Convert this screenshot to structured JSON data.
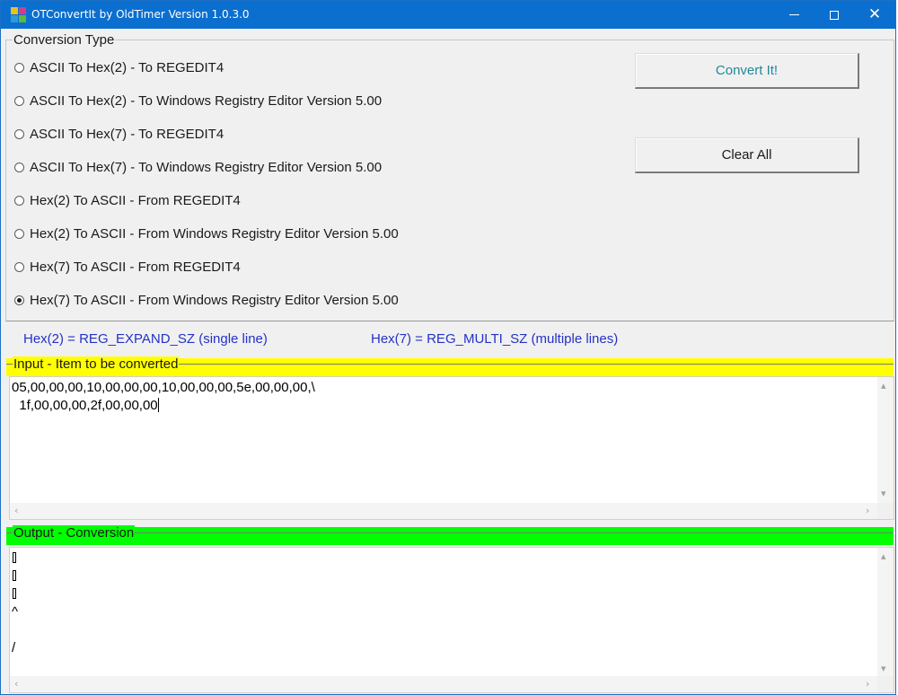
{
  "window": {
    "title": "OTConvertIt by OldTimer Version 1.0.3.0",
    "icon": "app-grid-icon",
    "controls": {
      "minimize": "minimize-icon",
      "maximize": "maximize-icon",
      "close": "✕"
    }
  },
  "conversion": {
    "group_title": "Conversion Type",
    "options": [
      {
        "label": "ASCII To Hex(2) - To REGEDIT4",
        "checked": false
      },
      {
        "label": "ASCII To Hex(2) - To Windows Registry Editor Version 5.00",
        "checked": false
      },
      {
        "label": "ASCII To Hex(7) - To REGEDIT4",
        "checked": false
      },
      {
        "label": "ASCII To Hex(7) - To Windows Registry Editor Version 5.00",
        "checked": false
      },
      {
        "label": "Hex(2) To ASCII - From REGEDIT4",
        "checked": false
      },
      {
        "label": "Hex(2) To ASCII - From Windows Registry Editor Version 5.00",
        "checked": false
      },
      {
        "label": "Hex(7) To ASCII - From REGEDIT4",
        "checked": false
      },
      {
        "label": "Hex(7) To ASCII - From Windows Registry Editor Version 5.00",
        "checked": true
      }
    ]
  },
  "buttons": {
    "convert": "Convert It!",
    "clear": "Clear All"
  },
  "hints": {
    "hex2": "Hex(2) = REG_EXPAND_SZ (single line)",
    "hex7": "Hex(7) = REG_MULTI_SZ (multiple lines)"
  },
  "input": {
    "label": "Input - Item to be converted",
    "lines": [
      "05,00,00,00,10,00,00,00,10,00,00,00,5e,00,00,00,\\",
      "  1f,00,00,00,2f,00,00,00"
    ]
  },
  "output": {
    "label": "Output - Conversion",
    "lines": [
      "",
      "",
      "",
      "^",
      "",
      "/"
    ]
  },
  "colors": {
    "titlebar": "#0b6fcf",
    "input_band": "#ffff00",
    "output_band": "#00ff00",
    "hint_text": "#2432c8",
    "convert_text": "#1e8a9a"
  },
  "scrollbars": {
    "up": "▴",
    "down": "▾",
    "left": "‹",
    "right": "›"
  }
}
